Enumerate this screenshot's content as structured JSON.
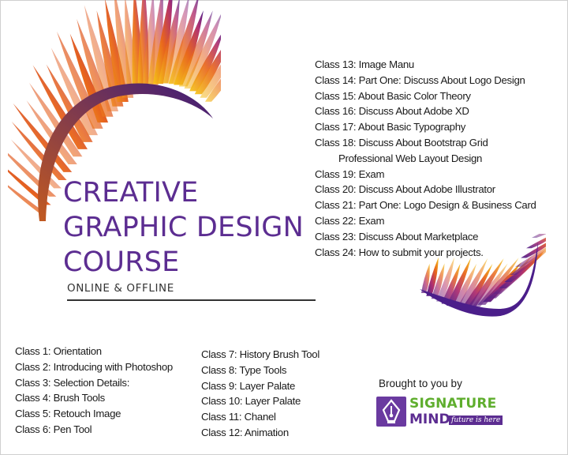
{
  "title": {
    "line1": "CREATIVE",
    "line2": "GRAPHIC DESIGN",
    "line3": "COURSE",
    "subtitle": "ONLINE & OFFLINE"
  },
  "classes_left": [
    "Class 1: Orientation",
    "Class 2: Introducing with Photoshop",
    "Class 3: Selection Details:",
    "Class 4: Brush Tools",
    "Class 5: Retouch Image",
    "Class 6: Pen Tool"
  ],
  "classes_middle": [
    "Class 7: History Brush Tool",
    "Class 8: Type Tools",
    "Class 9: Layer Palate",
    "Class 10: Layer Palate",
    "Class 11: Chanel",
    "Class 12: Animation"
  ],
  "classes_right": [
    "Class 13: Image Manu",
    "Class 14: Part One: Discuss About Logo Design",
    "Class 15: About Basic Color Theory",
    "Class 16: Discuss About Adobe XD",
    "Class 17: About Basic Typography",
    "Class 18: Discuss About Bootstrap Grid",
    "Professional Web Layout Design",
    "Class 19: Exam",
    "Class 20: Discuss About Adobe Illustrator",
    "Class 21: Part One: Logo Design & Business Card",
    "Class 22: Exam",
    "Class 23: Discuss About Marketplace",
    "Class 24: How to submit your projects."
  ],
  "sponsor": {
    "brought_text": "Brought to you by",
    "logo_word1": "SIGNATURE",
    "logo_word2": "MIND",
    "logo_tagline": "future is here"
  },
  "icons": [
    "feather-decoration",
    "pen-nib-icon"
  ],
  "colors": {
    "title": "#5c2d91",
    "logo_purple": "#6a3aa0",
    "logo_green": "#5fae2e",
    "feather_purple": "#4b1e8a",
    "feather_orange": "#e8651c",
    "feather_yellow": "#f5c418"
  }
}
